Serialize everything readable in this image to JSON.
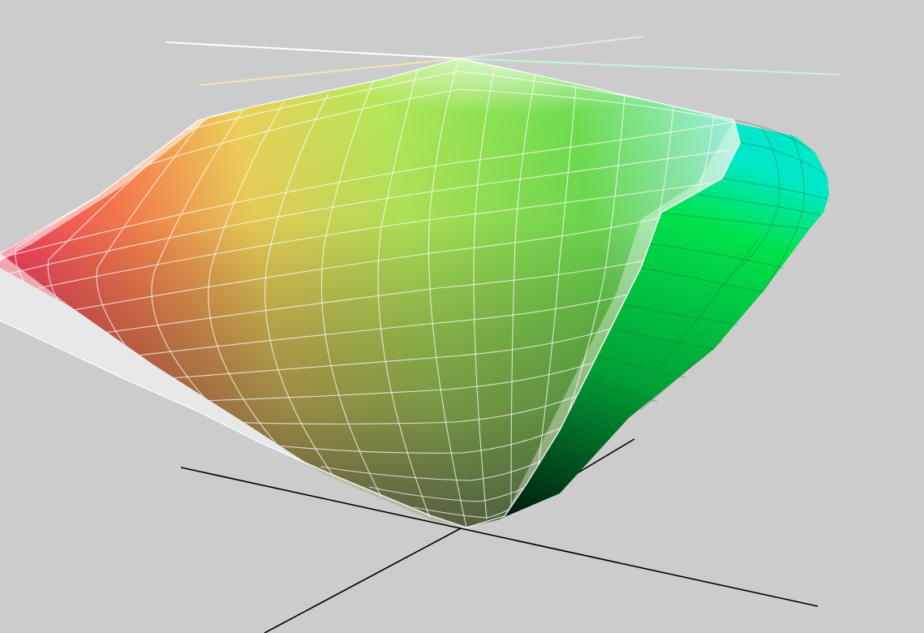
{
  "scene": {
    "type": "3d-gamut-comparison",
    "background": "#cccccc",
    "colors": {
      "black_axes": "#000000",
      "white_axes": "#ffffff",
      "gamut_white_mesh": "#ffffff",
      "wide_gamut_green": "#00e24a",
      "wide_gamut_dark_green": "#00220e",
      "wide_gamut_cyan": "#00e4d4",
      "ref_red": "#ff3a62",
      "ref_yellow": "#ffff6e",
      "ref_green": "#6edc50",
      "ref_gray": "#5a5a5a"
    },
    "meshes": [
      {
        "name": "wide-gamut-solid"
      },
      {
        "name": "reference-gamut-colored"
      },
      {
        "name": "reference-gamut-white-wireframe"
      }
    ]
  }
}
